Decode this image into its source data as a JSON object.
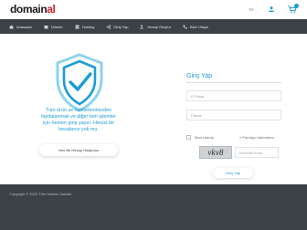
{
  "brand": {
    "logo_main": "domain",
    "logo_accent": "al"
  },
  "header": {
    "language": "TR"
  },
  "nav": {
    "items": [
      {
        "label": "Anasayfa",
        "icon": "home-icon"
      },
      {
        "label": "Ürünler",
        "icon": "box-icon"
      },
      {
        "label": "Hosting",
        "icon": "server-icon"
      },
      {
        "label": "Giriş Yap",
        "icon": "login-icon"
      },
      {
        "label": "Hesap Oluştur",
        "icon": "user-plus-icon"
      },
      {
        "label": "Bize Ulaşın",
        "icon": "phone-icon"
      }
    ]
  },
  "promo": {
    "text": "Tüm ürün ve hizmetlerimizden faydalanmak ve diğer tüm işlemler için hemen giriş yapın. Henüz bir hesabınız yok mu.",
    "register_label": "Yeni Bir Hesap Oluşturun"
  },
  "login": {
    "title": "Giriş Yap",
    "email_placeholder": "E-Posta",
    "password_placeholder": "Parola",
    "remember_label": "Beni Hatırla",
    "forgot_label": "» Parolayı Hatırlatma",
    "captcha_text": "vkv8",
    "captcha_placeholder": "Güvenlik Kodu",
    "submit_label": "Giriş Yap"
  },
  "footer": {
    "copyright": "Copyright © 2023 Tüm Hakları Saklıdır."
  },
  "colors": {
    "accent": "#1e9bd7",
    "dark": "#3b4147",
    "logo_accent": "#e3212b"
  }
}
